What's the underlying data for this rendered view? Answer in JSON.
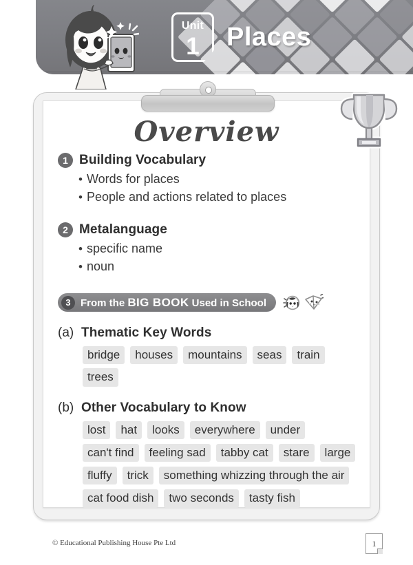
{
  "header": {
    "unit_word": "Unit",
    "unit_number": "1",
    "title": "Places",
    "bar_color": "#7c7d82",
    "mascot_icon": "girl-with-tablet-icon",
    "pattern_icon": "diamond-pattern"
  },
  "clipboard": {
    "clip_icon": "clipboard-clip-icon",
    "trophy_icon": "trophy-icon"
  },
  "overview": {
    "title": "Overview"
  },
  "sections": [
    {
      "number": "1",
      "title": "Building Vocabulary",
      "bullets": [
        "Words for places",
        "People and actions related to places"
      ]
    },
    {
      "number": "2",
      "title": "Metalanguage",
      "bullets": [
        "specific name",
        "noun"
      ]
    }
  ],
  "banner": {
    "number": "3",
    "text_before": "From the ",
    "text_big": "BIG BOOK",
    "text_after": " Used in School",
    "icon_girl": "girl-head-icon",
    "icon_book": "open-book-face-icon",
    "bg_color": "#7f7f82"
  },
  "subsections": [
    {
      "letter": "(a)",
      "title": "Thematic Key Words",
      "chips": [
        "bridge",
        "houses",
        "mountains",
        "seas",
        "train",
        "trees"
      ]
    },
    {
      "letter": "(b)",
      "title": "Other Vocabulary to Know",
      "chips": [
        "lost",
        "hat",
        "looks",
        "everywhere",
        "under",
        "can't find",
        "feeling sad",
        "tabby cat",
        "stare",
        "large",
        "fluffy",
        "trick",
        "something whizzing through the air",
        "cat food dish",
        "two seconds",
        "tasty fish"
      ]
    }
  ],
  "footer": {
    "copyright": "© Educational Publishing House Pte Ltd",
    "page_number": "1"
  }
}
